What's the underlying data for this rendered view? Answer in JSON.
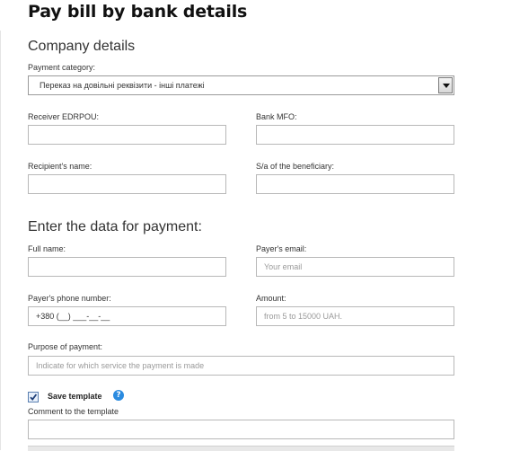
{
  "page": {
    "title": "Pay bill by bank details"
  },
  "company": {
    "section_title": "Company details",
    "payment_category_label": "Payment category:",
    "payment_category_value": "Переказ на довільні реквізити - інші платежі",
    "receiver_edrpou_label": "Receiver EDRPOU:",
    "receiver_edrpou_value": "",
    "bank_mfo_label": "Bank MFO:",
    "bank_mfo_value": "",
    "recipient_name_label": "Recipient's name:",
    "recipient_name_value": "",
    "beneficiary_account_label": "S/a of the beneficiary:",
    "beneficiary_account_value": ""
  },
  "payment": {
    "section_title": "Enter the data for payment:",
    "full_name_label": "Full name:",
    "full_name_value": "",
    "email_label": "Payer's email:",
    "email_placeholder": "Your email",
    "phone_label": "Payer's phone number:",
    "phone_value": "+380 (__) ___-__-__",
    "amount_label": "Amount:",
    "amount_placeholder": "from 5 to 15000 UAH.",
    "purpose_label": "Purpose of payment:",
    "purpose_placeholder": "Indicate for which service the payment is made"
  },
  "template": {
    "save_label": "Save template",
    "save_checked": true,
    "help_icon": "?",
    "comment_label": "Comment to the template",
    "comment_value": ""
  }
}
